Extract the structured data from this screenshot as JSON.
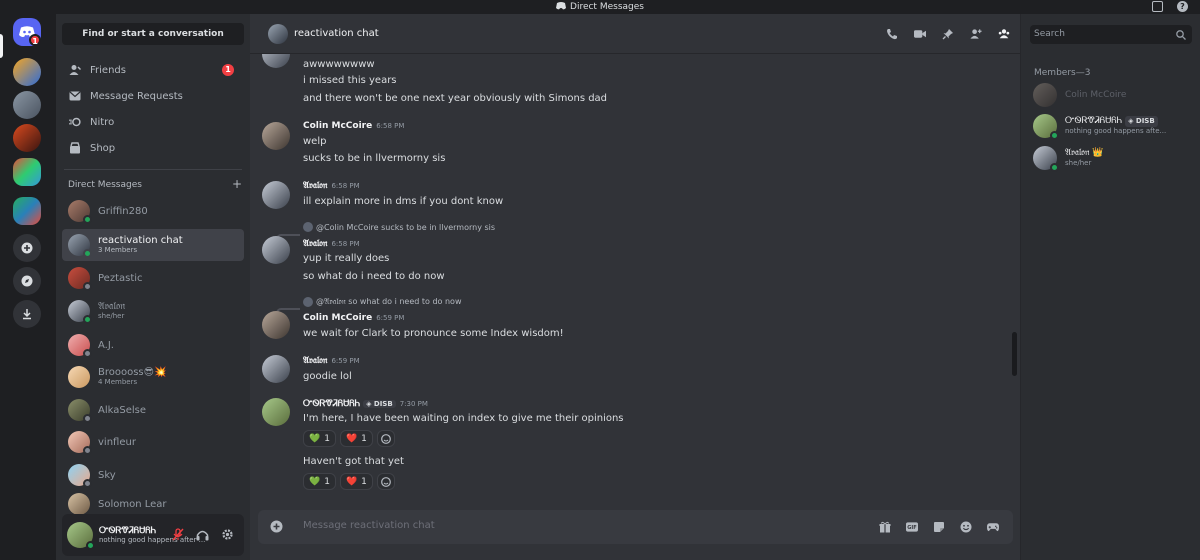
{
  "titlebar": {
    "title": "Direct Messages"
  },
  "rail": {
    "home_badge": "1"
  },
  "sidebar": {
    "find": "Find or start a conversation",
    "nav": [
      {
        "label": "Friends",
        "badge": "1"
      },
      {
        "label": "Message Requests"
      },
      {
        "label": "Nitro"
      },
      {
        "label": "Shop"
      }
    ],
    "dm_header": "Direct Messages",
    "dm_add": "+",
    "dms": [
      {
        "name": "Griffin280",
        "sub": ""
      },
      {
        "name": "reactivation chat",
        "sub": "3 Members"
      },
      {
        "name": "Peztastic",
        "sub": ""
      },
      {
        "name": "𝔄𝔳𝔞𝔩𝔬𝔫",
        "sub": "she/her"
      },
      {
        "name": "A.J.",
        "sub": ""
      },
      {
        "name": "Brooooss😎💥",
        "sub": "4 Members"
      },
      {
        "name": "AlkaSelse",
        "sub": ""
      },
      {
        "name": "vinfleur",
        "sub": ""
      },
      {
        "name": "Sky",
        "sub": ""
      },
      {
        "name": "Solomon Lear",
        "sub": ""
      }
    ],
    "user": {
      "name": "ᏅᏫᏒᏡᏘᏲᏌᏲᏂ",
      "status": "nothing good happens after ..."
    }
  },
  "chat": {
    "title": "reactivation chat",
    "messages": [
      {
        "lines": [
          "awwwwwwww",
          "i missed this years",
          "and there won't be one next year obviously with Simons dad"
        ]
      },
      {
        "author": "Colin McCoire",
        "time": "6:58 PM",
        "lines": [
          "welp",
          "sucks to be in llvermorny sis"
        ]
      },
      {
        "author": "𝔄𝔳𝔞𝔩𝔬𝔫",
        "time": "6:58 PM",
        "lines": [
          "ill explain more in dms if you dont know"
        ]
      },
      {
        "reply": "@Colin McCoire sucks to be in llvermorny sis",
        "author": "𝔄𝔳𝔞𝔩𝔬𝔫",
        "time": "6:58 PM",
        "lines": [
          "yup it really does",
          "so what do i need to do now"
        ]
      },
      {
        "reply": "@𝔄𝔳𝔞𝔩𝔬𝔫 so what do i need to do now",
        "author": "Colin McCoire",
        "time": "6:59 PM",
        "lines": [
          "we wait for Clark to pronounce some Index wisdom!"
        ]
      },
      {
        "author": "𝔄𝔳𝔞𝔩𝔬𝔫",
        "time": "6:59 PM",
        "lines": [
          "goodie lol"
        ]
      },
      {
        "author": "ᏅᏫᏒᏡᏘᏲᏌᏲᏂ",
        "tag": "DISB",
        "time": "7:30 PM",
        "lines": [
          "I'm here, I have been waiting on index to give me their opinions",
          "Haven't got that yet"
        ],
        "reactions": [
          {
            "emoji": "💚",
            "count": "1"
          },
          {
            "emoji": "❤️",
            "count": "1"
          }
        ]
      }
    ],
    "composer_placeholder": "Message reactivation chat"
  },
  "members": {
    "search_placeholder": "Search",
    "header": "Members—3",
    "list": [
      {
        "name": "Colin McCoire",
        "sub": "",
        "status": "offline"
      },
      {
        "name": "ᏅᏫᏒᏡᏘᏲᏌᏲᏂ",
        "tag": "DISB",
        "sub": "nothing good happens afte...",
        "status": "online"
      },
      {
        "name": "𝔄𝔳𝔞𝔩𝔬𝔫 👑",
        "sub": "she/her",
        "status": "online"
      }
    ]
  },
  "colors": {
    "accent": "#5865f2",
    "online": "#23a55a",
    "danger": "#f23f43"
  },
  "icons": [
    "discord-logo-icon",
    "friends-icon",
    "message-requests-icon",
    "nitro-icon",
    "shop-icon",
    "call-icon",
    "video-icon",
    "pin-icon",
    "add-member-icon",
    "members-icon",
    "search-icon",
    "inbox-icon",
    "help-icon",
    "mic-muted-icon",
    "headphones-icon",
    "settings-icon",
    "gift-icon",
    "gif-icon",
    "sticker-icon",
    "emoji-icon",
    "apps-icon"
  ]
}
